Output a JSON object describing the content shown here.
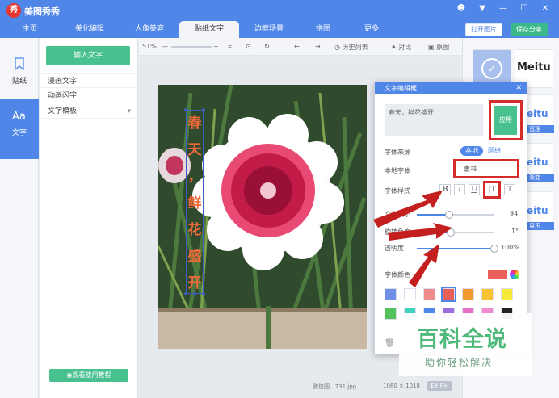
{
  "app": {
    "name": "美图秀秀",
    "logo_text": "秀"
  },
  "window_controls": [
    "☻",
    "▼",
    "—",
    "☐",
    "✕"
  ],
  "tabs": [
    "主页",
    "美化编辑",
    "人像美容",
    "贴纸文字",
    "边框场景",
    "拼图",
    "更多"
  ],
  "active_tab": "贴纸文字",
  "header_buttons": {
    "open": "打开图片",
    "save": "保存分享"
  },
  "left_nav": [
    {
      "label": "贴纸"
    },
    {
      "label": "文字"
    }
  ],
  "middle_panel": {
    "input_button": "输入文字",
    "items": [
      "漫画文字",
      "动画闪字",
      "文字模板"
    ],
    "tutorial": "观看使用教程"
  },
  "toolbar": {
    "zoom": "51%",
    "history": "历史列表",
    "compare": "对比",
    "original": "原图"
  },
  "canvas": {
    "vertical_text": [
      "春",
      "天",
      "，",
      "鲜",
      "花",
      "盛",
      "开"
    ],
    "filename": "微信图...731.jpg",
    "dimensions": "1080 × 1018",
    "exif": "EXIF+"
  },
  "sticker_panel": {
    "labels": [
      "",
      "Meitu",
      "eitu",
      "eitu",
      "eitu"
    ],
    "captions": [
      "",
      "",
      "宽理",
      "渐变",
      "果乐"
    ]
  },
  "dialog": {
    "title": "文字编辑框",
    "text_content": "春天，鲜花盛开",
    "apply": "应用",
    "font_source_label": "字体来源",
    "font_source_options": [
      "本地",
      "网络"
    ],
    "local_font_label": "本地字体",
    "local_font_value": "隶书",
    "font_style_label": "字体样式",
    "style_buttons": [
      "B",
      "I",
      "U",
      "|T",
      "T"
    ],
    "size_label": "文字大小",
    "size_value": "94",
    "rotation_label": "旋转角度",
    "rotation_value": "1°",
    "opacity_label": "透明度",
    "opacity_value": "100%",
    "color_label": "字体颜色",
    "current_color": "#e9605a",
    "swatches": [
      "#6f8ee8",
      "#ffffff",
      "#f08b8b",
      "#e9605a",
      "#f39a2e",
      "#f7c335",
      "#f5e93a",
      "#53c45b",
      "#42d0c0",
      "#4f86e8",
      "#9b6be0",
      "#e86fc3",
      "#f28ad0",
      "#222222"
    ],
    "size_fraction": 0.42,
    "rotation_fraction": 0.44,
    "opacity_fraction": 1.0
  },
  "watermark": {
    "title": "百科全说",
    "subtitle": "助你轻松解决"
  },
  "colors": {
    "accent": "#4f86e8",
    "green": "#49c18f",
    "highlight": "#d42b2b",
    "text_orange": "#ef6a3a"
  }
}
